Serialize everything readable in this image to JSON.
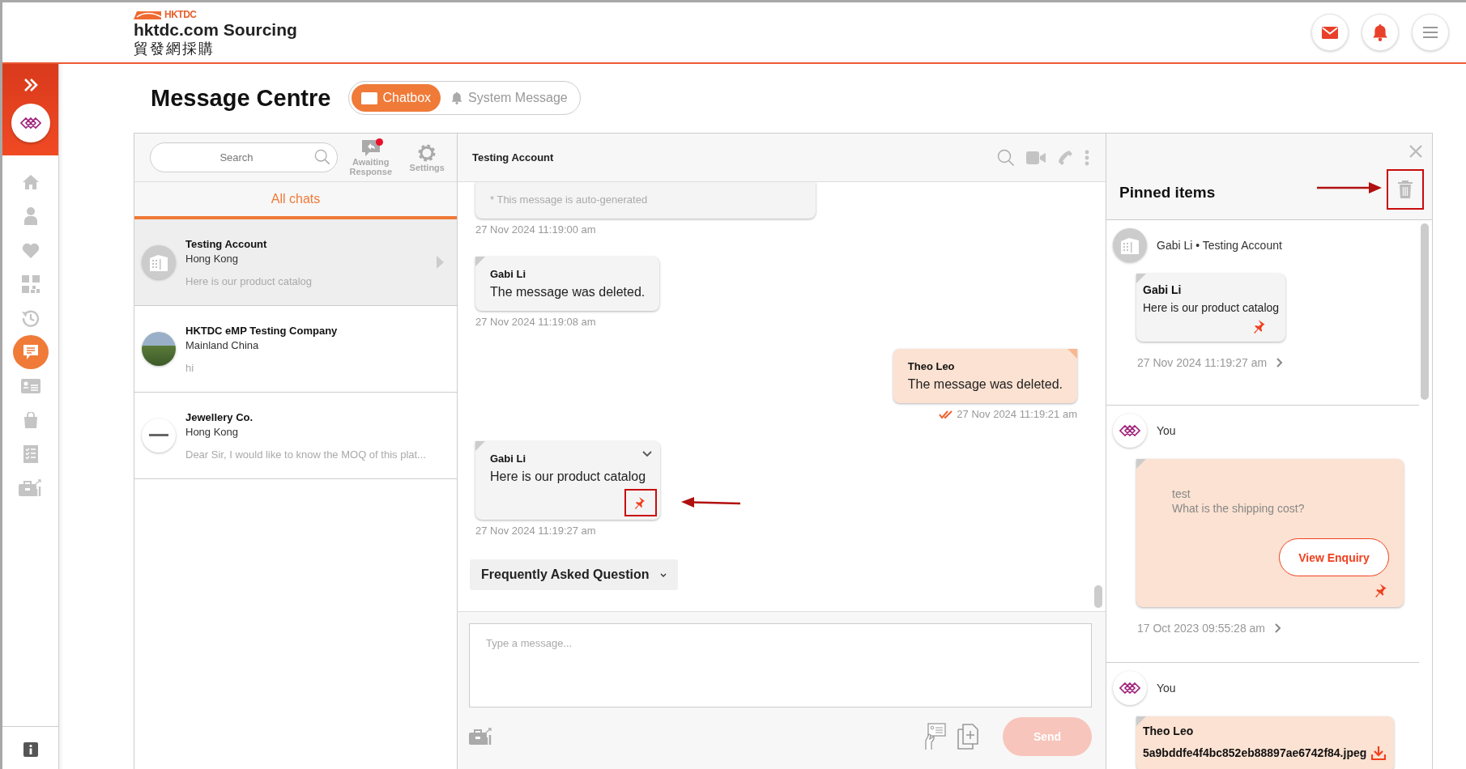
{
  "header": {
    "brand_mark": "HKTDC",
    "brand_name": "hktdc.com Sourcing",
    "brand_name_zh": "貿發網採購"
  },
  "sidebar": {
    "items": [
      {
        "kind": "home",
        "selected": false
      },
      {
        "kind": "person",
        "selected": false
      },
      {
        "kind": "heart",
        "selected": false
      },
      {
        "kind": "qr",
        "selected": false
      },
      {
        "kind": "history",
        "selected": false
      },
      {
        "kind": "chat",
        "selected": true
      },
      {
        "kind": "card",
        "selected": false
      },
      {
        "kind": "bag",
        "selected": false
      },
      {
        "kind": "checklist",
        "selected": false
      },
      {
        "kind": "briefcase",
        "selected": false
      }
    ]
  },
  "page_title": "Message Centre",
  "tabs": [
    {
      "label": "Chatbox",
      "kind": "mail",
      "selected": true
    },
    {
      "label": "System Message",
      "kind": "bell",
      "selected": false
    }
  ],
  "chat_list": {
    "search": {
      "placeholder": "Search"
    },
    "tools": [
      {
        "label": "Awaiting Response",
        "kind": "awaiting",
        "badge": true
      },
      {
        "label": "Settings",
        "kind": "settings",
        "badge": false
      }
    ],
    "filter_tabs": [
      {
        "label": "All chats",
        "selected": true
      }
    ],
    "chats": [
      {
        "name": "Testing Account",
        "region": "Hong Kong",
        "preview": "Here is our product catalog",
        "avatar": {
          "kind": "building"
        },
        "selected": true
      },
      {
        "name": "HKTDC eMP Testing Company",
        "region": "Mainland China",
        "preview": "hi",
        "avatar": {
          "kind": "photo"
        },
        "selected": false
      },
      {
        "name": "Jewellery Co.",
        "region": "Hong Kong",
        "preview": "Dear Sir, I would like to know the MOQ of this plat...",
        "avatar": {
          "kind": "logo"
        },
        "selected": false
      }
    ]
  },
  "conversation": {
    "title": "Testing Account",
    "messages": [
      {
        "kind": "system",
        "text": "* This message is auto-generated",
        "time": "27 Nov 2024 11:19:00 am"
      },
      {
        "kind": "incoming",
        "sender": "Gabi Li",
        "text": "The message was deleted.",
        "time": "27 Nov 2024 11:19:08 am",
        "pinned": false
      },
      {
        "kind": "outgoing",
        "sender": "Theo Leo",
        "text": "The message was deleted.",
        "time": "27 Nov 2024 11:19:21 am",
        "read": true
      },
      {
        "kind": "incoming",
        "sender": "Gabi Li",
        "text": "Here is our product catalog",
        "time": "27 Nov 2024 11:19:27 am",
        "pinned": true,
        "has_menu": true,
        "annotated": true
      }
    ],
    "faq": "Frequently Asked Question",
    "composer": {
      "placeholder": "Type a message...",
      "send": "Send",
      "send_disabled": true
    }
  },
  "pinned_panel": {
    "title": "Pinned items",
    "clear_annotated": true,
    "items": [
      {
        "kind": "text",
        "author": "Gabi Li • Testing Account",
        "avatar": {
          "kind": "building"
        },
        "sender": "Gabi Li",
        "text": "Here is our product catalog",
        "time": "27 Nov 2024 11:19:27 am"
      },
      {
        "kind": "enquiry",
        "author": "You",
        "avatar": {
          "kind": "logo"
        },
        "lines": [
          "test",
          "What is the shipping cost?"
        ],
        "button": "View Enquiry",
        "time": "17 Oct 2023 09:55:28 am"
      },
      {
        "kind": "file",
        "author": "You",
        "avatar": {
          "kind": "logo"
        },
        "sender": "Theo Leo",
        "file": "5a9bddfe4f4bc852eb88897ae6742f84.jpeg"
      }
    ]
  }
}
